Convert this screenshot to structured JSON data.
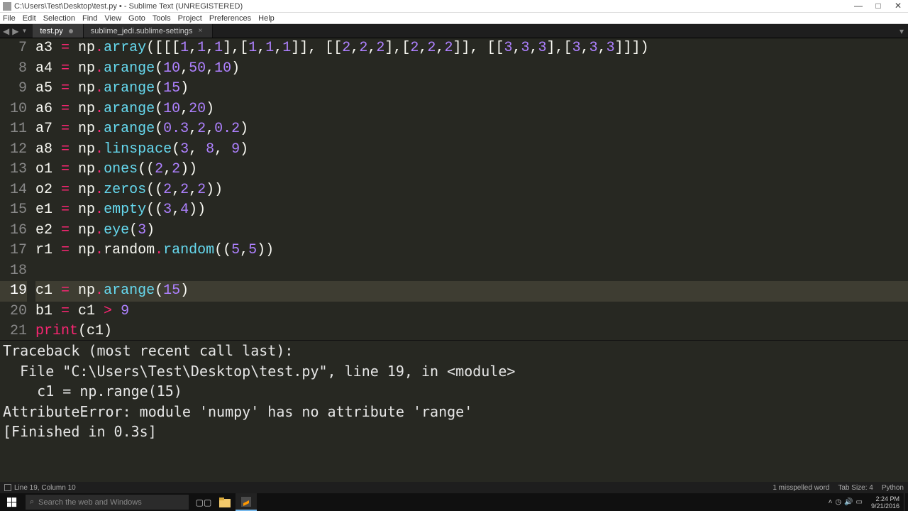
{
  "titlebar": {
    "path": "C:\\Users\\Test\\Desktop\\test.py • - Sublime Text (UNREGISTERED)"
  },
  "menu": [
    "File",
    "Edit",
    "Selection",
    "Find",
    "View",
    "Goto",
    "Tools",
    "Project",
    "Preferences",
    "Help"
  ],
  "tabs": [
    {
      "label": "test.py",
      "dirty": true,
      "active": true
    },
    {
      "label": "sublime_jedi.sublime-settings",
      "dirty": false,
      "active": false
    }
  ],
  "code": {
    "first_line": 7,
    "highlight_line": 19,
    "lines": [
      {
        "n": 7,
        "t": [
          [
            "nm",
            "a3 "
          ],
          [
            "op",
            "="
          ],
          [
            "nm",
            " np"
          ],
          [
            "op",
            "."
          ],
          [
            "fn",
            "array"
          ],
          [
            "pr",
            "([[["
          ],
          [
            "num",
            "1"
          ],
          [
            "pr",
            ","
          ],
          [
            "num",
            "1"
          ],
          [
            "pr",
            ","
          ],
          [
            "num",
            "1"
          ],
          [
            "pr",
            "],["
          ],
          [
            "num",
            "1"
          ],
          [
            "pr",
            ","
          ],
          [
            "num",
            "1"
          ],
          [
            "pr",
            ","
          ],
          [
            "num",
            "1"
          ],
          [
            "pr",
            "]], [["
          ],
          [
            "num",
            "2"
          ],
          [
            "pr",
            ","
          ],
          [
            "num",
            "2"
          ],
          [
            "pr",
            ","
          ],
          [
            "num",
            "2"
          ],
          [
            "pr",
            "],["
          ],
          [
            "num",
            "2"
          ],
          [
            "pr",
            ","
          ],
          [
            "num",
            "2"
          ],
          [
            "pr",
            ","
          ],
          [
            "num",
            "2"
          ],
          [
            "pr",
            "]], [["
          ],
          [
            "num",
            "3"
          ],
          [
            "pr",
            ","
          ],
          [
            "num",
            "3"
          ],
          [
            "pr",
            ","
          ],
          [
            "num",
            "3"
          ],
          [
            "pr",
            "],["
          ],
          [
            "num",
            "3"
          ],
          [
            "pr",
            ","
          ],
          [
            "num",
            "3"
          ],
          [
            "pr",
            ","
          ],
          [
            "num",
            "3"
          ],
          [
            "pr",
            "]]])"
          ]
        ]
      },
      {
        "n": 8,
        "t": [
          [
            "nm",
            "a4 "
          ],
          [
            "op",
            "="
          ],
          [
            "nm",
            " np"
          ],
          [
            "op",
            "."
          ],
          [
            "fn",
            "arange"
          ],
          [
            "pr",
            "("
          ],
          [
            "num",
            "10"
          ],
          [
            "pr",
            ","
          ],
          [
            "num",
            "50"
          ],
          [
            "pr",
            ","
          ],
          [
            "num",
            "10"
          ],
          [
            "pr",
            ")"
          ]
        ]
      },
      {
        "n": 9,
        "t": [
          [
            "nm",
            "a5 "
          ],
          [
            "op",
            "="
          ],
          [
            "nm",
            " np"
          ],
          [
            "op",
            "."
          ],
          [
            "fn",
            "arange"
          ],
          [
            "pr",
            "("
          ],
          [
            "num",
            "15"
          ],
          [
            "pr",
            ")"
          ]
        ]
      },
      {
        "n": 10,
        "t": [
          [
            "nm",
            "a6 "
          ],
          [
            "op",
            "="
          ],
          [
            "nm",
            " np"
          ],
          [
            "op",
            "."
          ],
          [
            "fn",
            "arange"
          ],
          [
            "pr",
            "("
          ],
          [
            "num",
            "10"
          ],
          [
            "pr",
            ","
          ],
          [
            "num",
            "20"
          ],
          [
            "pr",
            ")"
          ]
        ]
      },
      {
        "n": 11,
        "t": [
          [
            "nm",
            "a7 "
          ],
          [
            "op",
            "="
          ],
          [
            "nm",
            " np"
          ],
          [
            "op",
            "."
          ],
          [
            "fn",
            "arange"
          ],
          [
            "pr",
            "("
          ],
          [
            "num",
            "0.3"
          ],
          [
            "pr",
            ","
          ],
          [
            "num",
            "2"
          ],
          [
            "pr",
            ","
          ],
          [
            "num",
            "0.2"
          ],
          [
            "pr",
            ")"
          ]
        ]
      },
      {
        "n": 12,
        "t": [
          [
            "nm",
            "a8 "
          ],
          [
            "op",
            "="
          ],
          [
            "nm",
            " np"
          ],
          [
            "op",
            "."
          ],
          [
            "fn",
            "linspace"
          ],
          [
            "pr",
            "("
          ],
          [
            "num",
            "3"
          ],
          [
            "pr",
            ", "
          ],
          [
            "num",
            "8"
          ],
          [
            "pr",
            ", "
          ],
          [
            "num",
            "9"
          ],
          [
            "pr",
            ")"
          ]
        ]
      },
      {
        "n": 13,
        "t": [
          [
            "nm",
            "o1 "
          ],
          [
            "op",
            "="
          ],
          [
            "nm",
            " np"
          ],
          [
            "op",
            "."
          ],
          [
            "fn",
            "ones"
          ],
          [
            "pr",
            "(("
          ],
          [
            "num",
            "2"
          ],
          [
            "pr",
            ","
          ],
          [
            "num",
            "2"
          ],
          [
            "pr",
            "))"
          ]
        ]
      },
      {
        "n": 14,
        "t": [
          [
            "nm",
            "o2 "
          ],
          [
            "op",
            "="
          ],
          [
            "nm",
            " np"
          ],
          [
            "op",
            "."
          ],
          [
            "fn",
            "zeros"
          ],
          [
            "pr",
            "(("
          ],
          [
            "num",
            "2"
          ],
          [
            "pr",
            ","
          ],
          [
            "num",
            "2"
          ],
          [
            "pr",
            ","
          ],
          [
            "num",
            "2"
          ],
          [
            "pr",
            "))"
          ]
        ]
      },
      {
        "n": 15,
        "t": [
          [
            "nm",
            "e1 "
          ],
          [
            "op",
            "="
          ],
          [
            "nm",
            " np"
          ],
          [
            "op",
            "."
          ],
          [
            "fn",
            "empty"
          ],
          [
            "pr",
            "(("
          ],
          [
            "num",
            "3"
          ],
          [
            "pr",
            ","
          ],
          [
            "num",
            "4"
          ],
          [
            "pr",
            "))"
          ]
        ]
      },
      {
        "n": 16,
        "t": [
          [
            "nm",
            "e2 "
          ],
          [
            "op",
            "="
          ],
          [
            "nm",
            " np"
          ],
          [
            "op",
            "."
          ],
          [
            "fn",
            "eye"
          ],
          [
            "pr",
            "("
          ],
          [
            "num",
            "3"
          ],
          [
            "pr",
            ")"
          ]
        ]
      },
      {
        "n": 17,
        "t": [
          [
            "nm",
            "r1 "
          ],
          [
            "op",
            "="
          ],
          [
            "nm",
            " np"
          ],
          [
            "op",
            "."
          ],
          [
            "nm",
            "random"
          ],
          [
            "op",
            "."
          ],
          [
            "fn",
            "random"
          ],
          [
            "pr",
            "(("
          ],
          [
            "num",
            "5"
          ],
          [
            "pr",
            ","
          ],
          [
            "num",
            "5"
          ],
          [
            "pr",
            "))"
          ]
        ]
      },
      {
        "n": 18,
        "t": []
      },
      {
        "n": 19,
        "t": [
          [
            "nm",
            "c1 "
          ],
          [
            "op",
            "="
          ],
          [
            "nm",
            " np"
          ],
          [
            "op",
            "."
          ],
          [
            "fn",
            "arange"
          ],
          [
            "pr",
            "("
          ],
          [
            "num",
            "15"
          ],
          [
            "pr",
            ")"
          ]
        ]
      },
      {
        "n": 20,
        "t": [
          [
            "nm",
            "b1 "
          ],
          [
            "op",
            "="
          ],
          [
            "nm",
            " c1 "
          ],
          [
            "op",
            ">"
          ],
          [
            "nm",
            " "
          ],
          [
            "num",
            "9"
          ]
        ]
      },
      {
        "n": 21,
        "t": [
          [
            "kw",
            "print"
          ],
          [
            "pr",
            "(c1)"
          ]
        ]
      }
    ]
  },
  "console_lines": [
    "Traceback (most recent call last):",
    "  File \"C:\\Users\\Test\\Desktop\\test.py\", line 19, in <module>",
    "    c1 = np.range(15)",
    "AttributeError: module 'numpy' has no attribute 'range'",
    "[Finished in 0.3s]"
  ],
  "status": {
    "pos": "Line 19, Column 10",
    "spell": "1 misspelled word",
    "tabsize": "Tab Size: 4",
    "lang": "Python"
  },
  "taskbar": {
    "search_placeholder": "Search the web and Windows",
    "time": "2:24 PM",
    "date": "9/21/2016"
  }
}
